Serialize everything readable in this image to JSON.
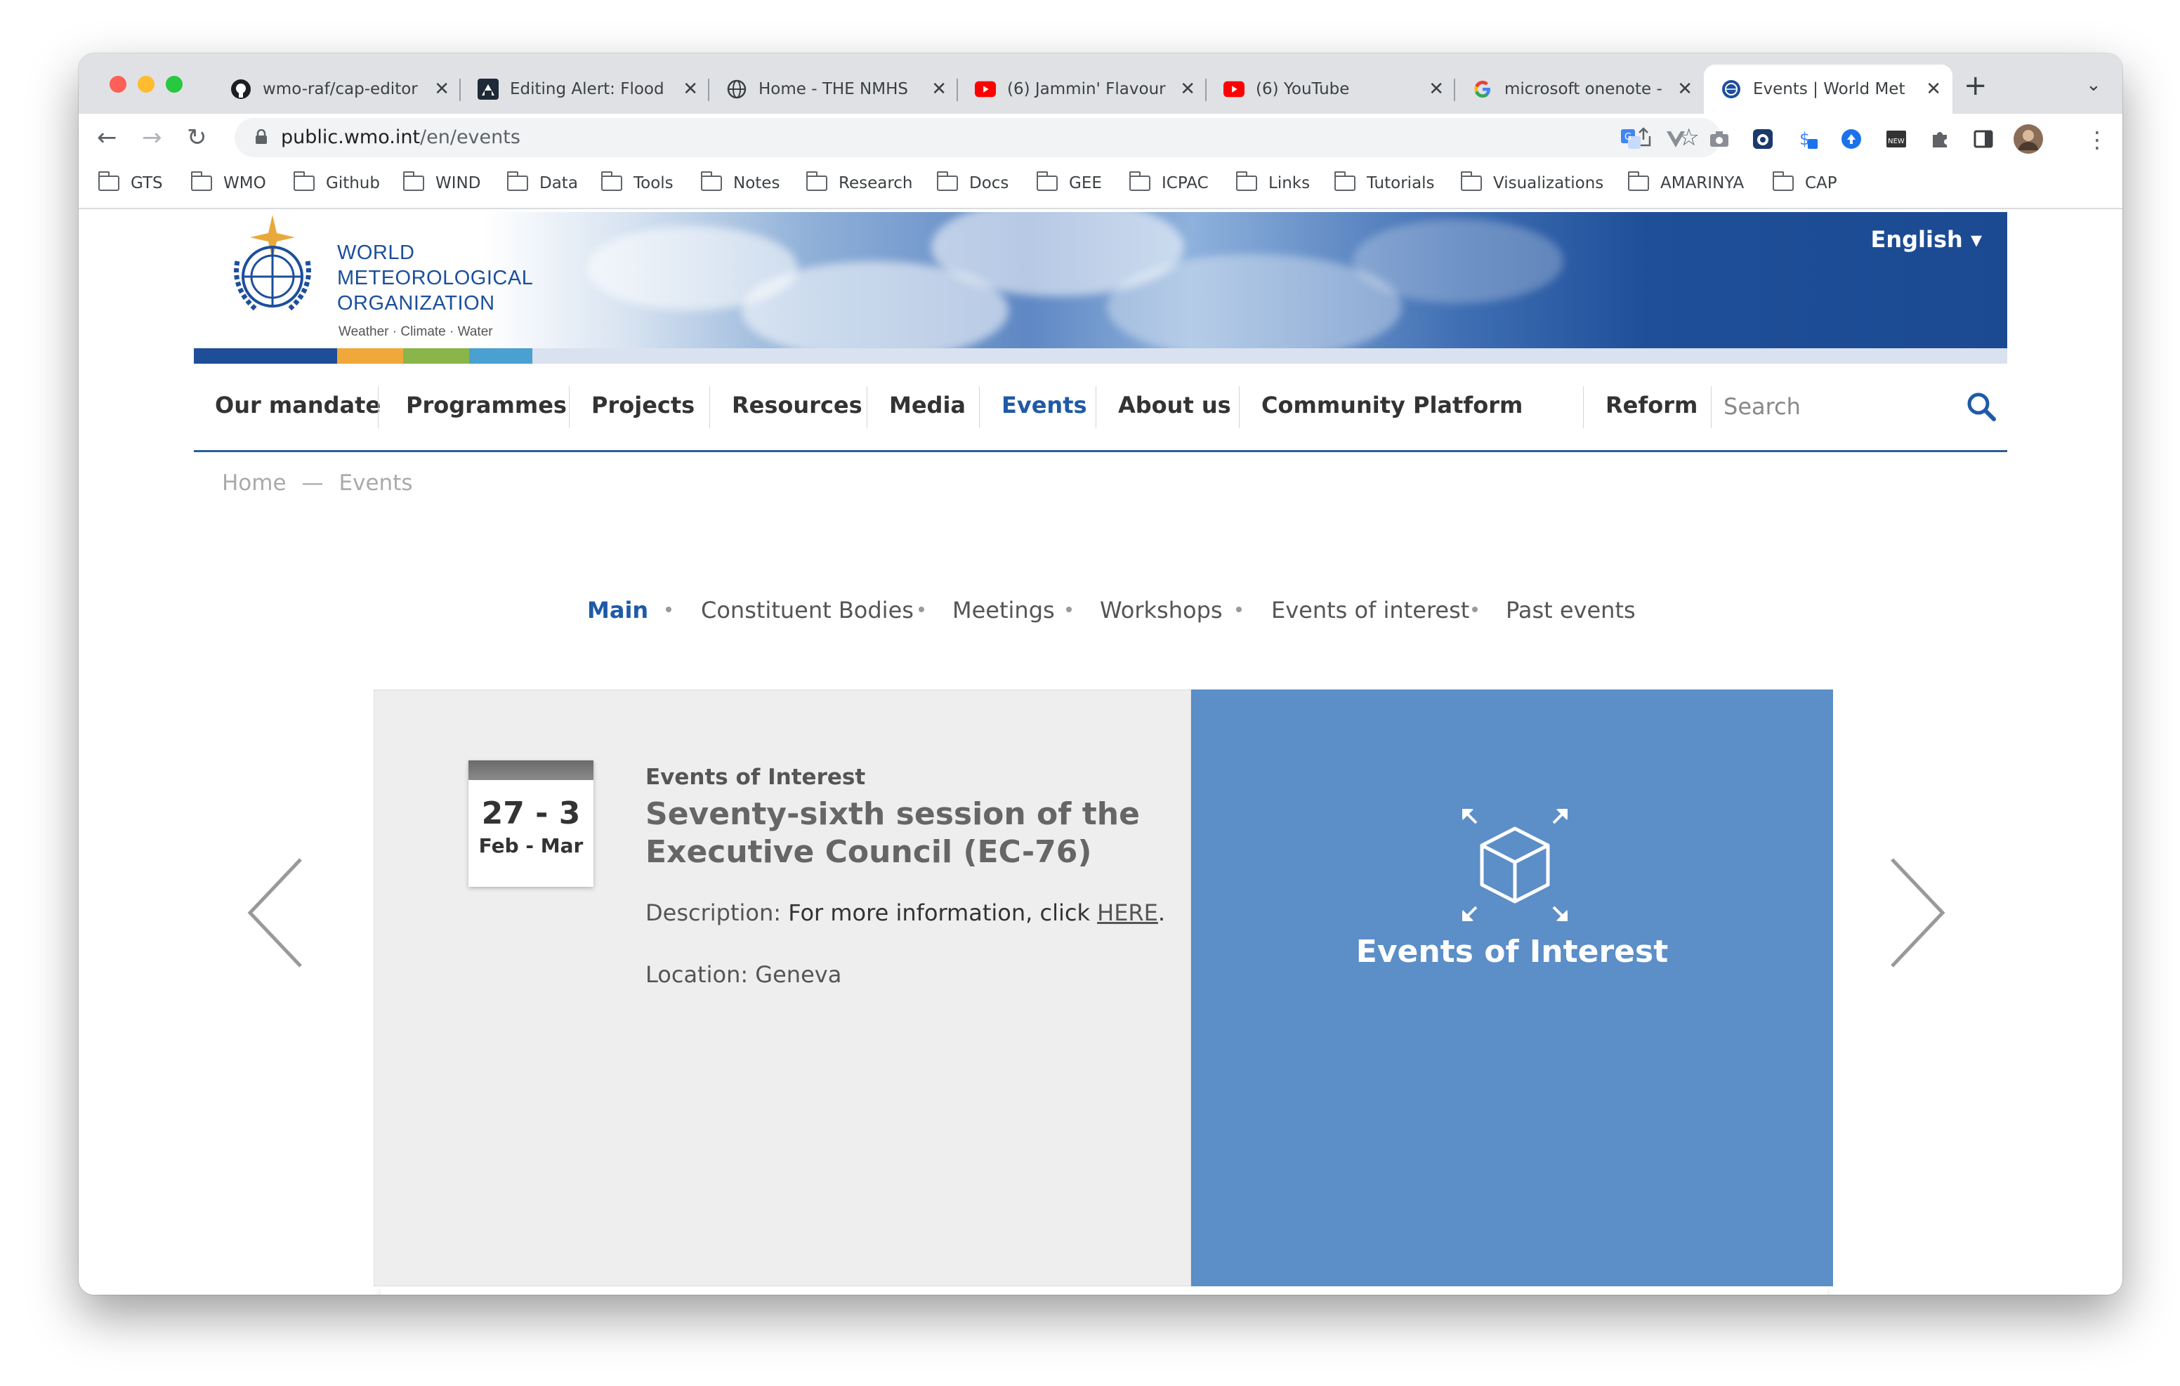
{
  "browser": {
    "tabs": [
      {
        "title": "wmo-raf/cap-editor",
        "icon": "github-icon"
      },
      {
        "title": "Editing Alert: Flood",
        "icon": "cap-icon"
      },
      {
        "title": "Home - THE NMHS",
        "icon": "globe-icon"
      },
      {
        "title": "(6) Jammin' Flavour",
        "icon": "youtube-icon"
      },
      {
        "title": "(6) YouTube",
        "icon": "youtube-icon"
      },
      {
        "title": "microsoft onenote -",
        "icon": "google-icon"
      },
      {
        "title": "Events | World Met",
        "icon": "wmo-icon",
        "active": true
      }
    ],
    "url_host": "public.wmo.int",
    "url_path": "/en/events",
    "bookmarks": [
      "GTS",
      "WMO",
      "Github",
      "WIND",
      "Data",
      "Tools",
      "Notes",
      "Research",
      "Docs",
      "GEE",
      "ICPAC",
      "Links",
      "Tutorials",
      "Visualizations",
      "AMARINYA",
      "CAP"
    ]
  },
  "header": {
    "org_line1": "WORLD",
    "org_line2": "METEOROLOGICAL",
    "org_line3": "ORGANIZATION",
    "tagline": "Weather · Climate · Water",
    "language": "English",
    "color_bar": [
      "#1f4e98",
      "#f0a83a",
      "#8ab54a",
      "#4aa0d0"
    ]
  },
  "nav": {
    "items": [
      "Our mandate",
      "Programmes",
      "Projects",
      "Resources",
      "Media",
      "Events",
      "About us",
      "Community Platform",
      "Reform"
    ],
    "active": "Events",
    "search_placeholder": "Search"
  },
  "breadcrumb": {
    "home": "Home",
    "separator": "—",
    "current": "Events"
  },
  "subnav": {
    "items": [
      "Main",
      "Constituent Bodies",
      "Meetings",
      "Workshops",
      "Events of interest",
      "Past events"
    ],
    "active": "Main"
  },
  "event": {
    "date_days": "27 - 3",
    "date_months": "Feb - Mar",
    "category": "Events of Interest",
    "title": "Seventy-sixth session of the Executive Council (EC-76)",
    "desc_label": "Description:",
    "desc_text": "For more information, click",
    "desc_link": "HERE",
    "desc_end": ".",
    "location": "Location: Geneva"
  },
  "feature": {
    "label": "Events of Interest",
    "bg_color": "#5c8ec7"
  }
}
